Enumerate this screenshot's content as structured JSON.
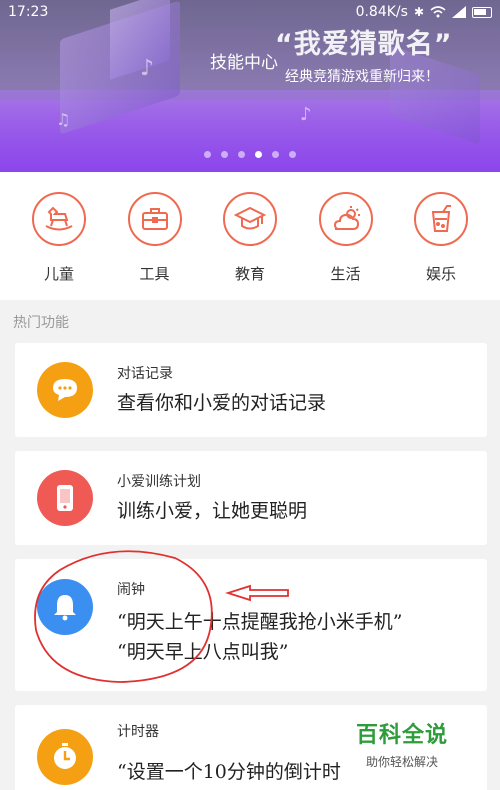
{
  "status_bar": {
    "time": "17:23",
    "network_speed": "0.84K/s"
  },
  "banner": {
    "title": "技能中心",
    "headline": "“我爱猜歌名”",
    "subtitle": "经典竞猜游戏重新归来！",
    "page_count": 6,
    "active_page": 4
  },
  "categories": [
    {
      "label": "儿童",
      "icon": "rocking-horse-icon"
    },
    {
      "label": "工具",
      "icon": "toolbox-icon"
    },
    {
      "label": "教育",
      "icon": "graduation-cap-icon"
    },
    {
      "label": "生活",
      "icon": "weather-icon"
    },
    {
      "label": "娱乐",
      "icon": "drink-icon"
    }
  ],
  "section_title": "热门功能",
  "features": [
    {
      "title": "对话记录",
      "lines": [
        "查看你和小爱的对话记录"
      ],
      "icon": "chat-bubble-icon",
      "color": "#f5a012"
    },
    {
      "title": "小爱训练计划",
      "lines": [
        "训练小爱，让她更聪明"
      ],
      "icon": "speaker-icon",
      "color": "#ef5a55"
    },
    {
      "title": "闹钟",
      "lines": [
        "“明天上午十点提醒我抢小米手机”",
        "“明天早上八点叫我”"
      ],
      "icon": "bell-icon",
      "color": "#3a8ff0"
    },
    {
      "title": "计时器",
      "lines": [
        "“设置一个10分钟的倒计时"
      ],
      "icon": "stopwatch-icon",
      "color": "#f5a012"
    }
  ],
  "watermark": {
    "title": "百科全说",
    "subtitle": "助你轻松解决"
  },
  "colors": {
    "accent": "#ef6a50",
    "banner": "#8a4fe6",
    "annotation": "#e03030"
  }
}
